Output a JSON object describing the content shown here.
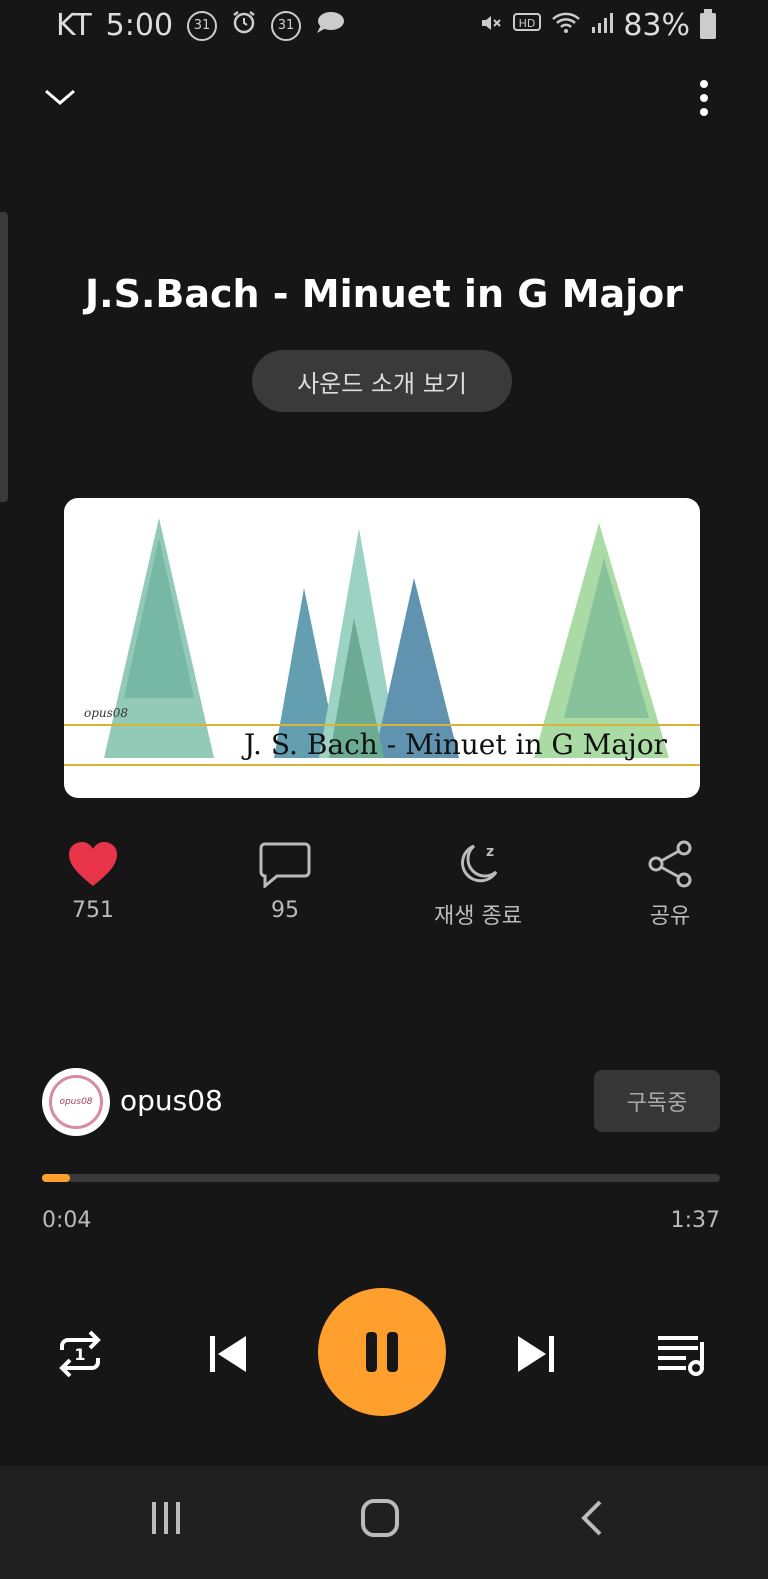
{
  "status_bar": {
    "carrier": "KT",
    "time": "5:00",
    "notif_badges": [
      "31",
      "31"
    ],
    "battery": "83%",
    "icons": [
      "calendar-icon",
      "alarm-icon",
      "calendar-icon",
      "chat-icon",
      "mute-icon",
      "hd-icon",
      "wifi-icon",
      "signal-icon",
      "battery-icon"
    ]
  },
  "header": {
    "collapse_icon": "chevron-down-icon",
    "more_icon": "more-vertical-icon"
  },
  "track": {
    "title": "J.S.Bach - Minuet in G Major",
    "intro_button": "사운드 소개 보기",
    "art_caption": "J. S. Bach - Minuet  in G Major",
    "art_logo": "opus08"
  },
  "actions": {
    "like": {
      "icon": "heart-icon",
      "count": "751",
      "color": "#e8354a"
    },
    "comment": {
      "icon": "comment-icon",
      "count": "95"
    },
    "sleep": {
      "icon": "moon-sleep-icon",
      "label": "재생 종료"
    },
    "share": {
      "icon": "share-icon",
      "label": "공유"
    }
  },
  "channel": {
    "name": "opus08",
    "avatar_text": "opus08",
    "subscribe_label": "구독중"
  },
  "progress": {
    "elapsed": "0:04",
    "duration": "1:37",
    "fraction": 0.041,
    "accent": "#ff9f2e"
  },
  "controls": {
    "repeat_icon": "repeat-one-icon",
    "prev_icon": "skip-previous-icon",
    "play_state_icon": "pause-icon",
    "next_icon": "skip-next-icon",
    "playlist_icon": "playlist-icon"
  },
  "nav": {
    "icons": [
      "recent-apps-icon",
      "home-icon",
      "back-icon"
    ]
  }
}
